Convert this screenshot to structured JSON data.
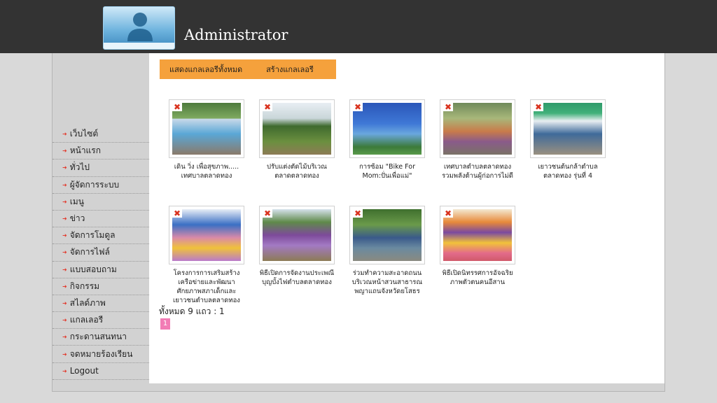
{
  "header": {
    "title": "Administrator"
  },
  "sidebar": {
    "items": [
      {
        "label": "เว็บไซต์"
      },
      {
        "label": "หน้าแรก"
      },
      {
        "label": "ทั่วไป"
      },
      {
        "label": "ผู้จัดการระบบ"
      },
      {
        "label": "เมนู"
      },
      {
        "label": "ข่าว"
      },
      {
        "label": "จัดการโมดูล"
      },
      {
        "label": "จัดการไฟล์"
      },
      {
        "label": "แบบสอบถาม"
      },
      {
        "label": "กิจกรรม"
      },
      {
        "label": "สไลด์ภาพ"
      },
      {
        "label": "แกลเลอรี"
      },
      {
        "label": "กระดานสนทนา"
      },
      {
        "label": "จดหมายร้องเรียน"
      },
      {
        "label": "Logout"
      }
    ]
  },
  "tabs": {
    "show_all": "แสดงแกลเลอรีทั้งหมด",
    "create": "สร้างแกลเลอรี"
  },
  "gallery": {
    "items": [
      {
        "caption": "เดิน วิ่ง เพื่อสุขภาพ..... เทศบาลตลาดทอง"
      },
      {
        "caption": "ปรับแต่งตัดไม้บริเวณตลาดตลาดทอง"
      },
      {
        "caption": "การซ้อม \"Bike For Mom:ปั่นเพื่อแม่\""
      },
      {
        "caption": "เทศบาลตำบลตลาดทอง รวมพลังต้านผู้ก่อการไม่ดี"
      },
      {
        "caption": "เยาวชนต้นกล้าตำบลตลาดทอง รุ่นที่ 4"
      },
      {
        "caption": "โครงการการเสริมสร้างเครือข่ายและพัฒนาศักยภาพสภาเด็กและเยาวชนตำบลตลาดทอง"
      },
      {
        "caption": "พิธีเปิดการจัดงานประเพณีบุญบั้งไฟตำบลตลาดทอง"
      },
      {
        "caption": "ร่วมทำความสะอาดถนน บริเวณหน้าสวนสาธารณพญาแถนจังหวัดยโสธร"
      },
      {
        "caption": "พิธีเปิดนิทรรศการอัจฉริยภาพตัวตนคนอีสาน"
      }
    ]
  },
  "summary": "ทั้งหมด 9 แถว : 1",
  "pagination": {
    "current": "1"
  },
  "colors": {
    "header_bg": "#333333",
    "tab_bg": "#f5a13c",
    "page_active": "#f27cb5",
    "arrow": "#e23b2e"
  },
  "icons": {
    "avatar": "user-silhouette-icon",
    "nav_arrow": "arrow-right-icon",
    "broken_image": "broken-image-icon"
  }
}
